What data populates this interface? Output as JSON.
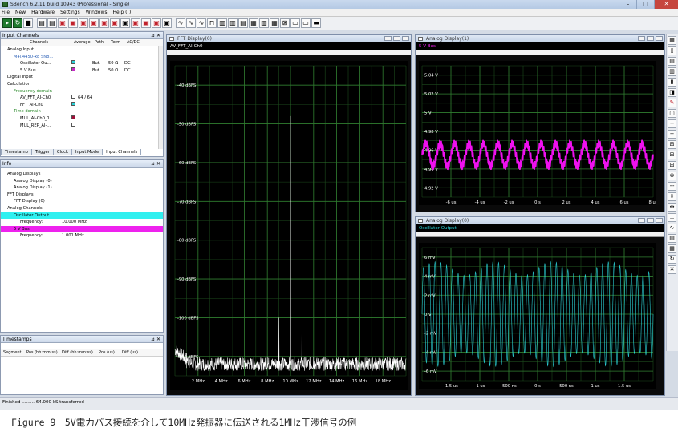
{
  "app": {
    "title": "SBench 6.2.11 build 10943 (Professional - Single)",
    "min": "–",
    "max": "□",
    "close": "✕"
  },
  "menu": [
    "File",
    "New",
    "Hardware",
    "Settings",
    "Windows",
    "Help (!)"
  ],
  "input_channels": {
    "header": "Input Channels",
    "columns": [
      "Channels",
      "Average",
      "Path",
      "Term",
      "AC/DC"
    ],
    "rows": [
      {
        "label": "Analog Input",
        "indent": 1,
        "swatch": "",
        "path": "",
        "term": "",
        "acdc": "",
        "avg": ""
      },
      {
        "label": "M4i.4450-x8 SN8...",
        "indent": 2,
        "swatch": "",
        "path": "",
        "term": "",
        "acdc": "",
        "avg": ""
      },
      {
        "label": "Oscillator Ou...",
        "indent": 3,
        "swatch": "#2bd3d8",
        "path": "Buf.",
        "term": "50 Ω",
        "acdc": "DC",
        "avg": ""
      },
      {
        "label": "5 V Bus",
        "indent": 3,
        "swatch": "#c728c7",
        "path": "Buf.",
        "term": "50 Ω",
        "acdc": "DC",
        "avg": ""
      },
      {
        "label": "Digital Input",
        "indent": 1,
        "swatch": "",
        "path": "",
        "term": "",
        "acdc": "",
        "avg": ""
      },
      {
        "label": "Calculation",
        "indent": 1,
        "swatch": "",
        "path": "",
        "term": "",
        "acdc": "",
        "avg": ""
      },
      {
        "label": "Frequency domain",
        "indent": 2,
        "swatch": "",
        "path": "",
        "term": "",
        "acdc": "",
        "avg": ""
      },
      {
        "label": "AV_FFT_AI-Ch0",
        "indent": 3,
        "swatch": "#ffffff",
        "path": "",
        "term": "",
        "acdc": "",
        "avg": "64 / 64"
      },
      {
        "label": "FFT_AI-Ch0",
        "indent": 3,
        "swatch": "#2bd3d8",
        "path": "",
        "term": "",
        "acdc": "",
        "avg": ""
      },
      {
        "label": "Time domain",
        "indent": 2,
        "swatch": "",
        "path": "",
        "term": "",
        "acdc": "",
        "avg": ""
      },
      {
        "label": "MUL_AI-Ch0_1",
        "indent": 3,
        "swatch": "#a0103a",
        "path": "",
        "term": "",
        "acdc": "",
        "avg": ""
      },
      {
        "label": "MUL_REP_AI-...",
        "indent": 3,
        "swatch": "#ffffff",
        "path": "",
        "term": "",
        "acdc": "",
        "avg": ""
      }
    ],
    "tabs": [
      "Timestamp",
      "Trigger",
      "Clock",
      "Input Mode",
      "Input Channels"
    ]
  },
  "info": {
    "header": "Info",
    "rows": [
      {
        "label": "Analog Displays",
        "indent": 1,
        "bg": ""
      },
      {
        "label": "Analog Display (0)",
        "indent": 2,
        "bg": ""
      },
      {
        "label": "Analog Display (1)",
        "indent": 2,
        "bg": ""
      },
      {
        "label": "FFT Displays",
        "indent": 1,
        "bg": ""
      },
      {
        "label": "FFT Display (0)",
        "indent": 2,
        "bg": ""
      },
      {
        "label": "Analog Channels",
        "indent": 1,
        "bg": ""
      },
      {
        "label": "Oscillator Output",
        "indent": 2,
        "bg": "#30f0f0"
      },
      {
        "label": "Frequency:",
        "value": "10.000 MHz",
        "indent": 3,
        "bg": ""
      },
      {
        "label": "5 V Bus",
        "indent": 2,
        "bg": "#ee22ee"
      },
      {
        "label": "Frequency:",
        "value": "1.001 MHz",
        "indent": 3,
        "bg": ""
      }
    ]
  },
  "timestamps": {
    "header": "Timestamps",
    "columns": [
      "Segment",
      "Pos (hh:mm:ss)",
      "Diff (hh:mm:ss)",
      "Pos (us)",
      "Diff (us)"
    ]
  },
  "status": "Finished ......... 64.000 kS transferred",
  "fft_window": {
    "title": "FFT Display(0)",
    "channel": "AV_FFT_AI-Ch0"
  },
  "ad1_window": {
    "title": "Analog Display(1)",
    "channel": "5 V Bus"
  },
  "ad0_window": {
    "title": "Analog Display(0)",
    "channel": "Oscillator Output"
  },
  "caption": "Figure 9　5V電力バス接続を介して10MHz発振器に伝送される1MHz干渉信号の例",
  "chart_data": [
    {
      "type": "line",
      "title": "FFT Display(0)",
      "series_name": "AV_FFT_AI-Ch0",
      "color": "#ffffff",
      "xlabel": "",
      "ylabel": "",
      "xlim": [
        0,
        20
      ],
      "ylim": [
        -115,
        -35
      ],
      "x_ticks": [
        "2 MHz",
        "4 MHz",
        "6 MHz",
        "8 MHz",
        "10 MHz",
        "12 MHz",
        "14 MHz",
        "16 MHz",
        "18 MHz"
      ],
      "y_ticks": [
        "-40 dBFS",
        "-50 dBFS",
        "-60 dBFS",
        "-70 dBFS",
        "-80 dBFS",
        "-90 dBFS",
        "-100 dBFS",
        "-110 dBFS"
      ],
      "peaks": [
        {
          "x": 10.0,
          "y": -48
        },
        {
          "x": 9.0,
          "y": -100
        },
        {
          "x": 11.0,
          "y": -100
        },
        {
          "x": 1.0,
          "y": -109
        },
        {
          "x": 8.0,
          "y": -110
        },
        {
          "x": 12.0,
          "y": -110
        }
      ],
      "noise_floor": -113,
      "grid": true
    },
    {
      "type": "line",
      "title": "Analog Display(1)",
      "series_name": "5 V Bus",
      "color": "#ee11ee",
      "xlabel": "",
      "ylabel": "",
      "xlim": [
        -8,
        8
      ],
      "ylim": [
        4.91,
        5.05
      ],
      "x_ticks": [
        "-6 us",
        "-4 us",
        "-2 us",
        "0 s",
        "2 us",
        "4 us",
        "6 us",
        "8 us"
      ],
      "y_ticks": [
        "5.04 V",
        "5.02 V",
        "5 V",
        "4.98 V",
        "4.96 V",
        "4.94 V",
        "4.92 V"
      ],
      "signal": {
        "offset": 4.955,
        "amplitude": 0.012,
        "frequency_mhz": 1.001,
        "ripple": 0.004
      },
      "grid": true
    },
    {
      "type": "line",
      "title": "Analog Display(0)",
      "series_name": "Oscillator Output",
      "color": "#2bd3d8",
      "xlabel": "",
      "ylabel": "",
      "xlim": [
        -2000,
        2000
      ],
      "ylim": [
        -7,
        7
      ],
      "x_ticks": [
        "-1.5 us",
        "-1 us",
        "-500 ns",
        "0 s",
        "500 ns",
        "1 us",
        "1.5 us"
      ],
      "y_ticks": [
        "6 mV",
        "4 mV",
        "2 mV",
        "0 V",
        "-2 mV",
        "-4 mV",
        "-6 mV"
      ],
      "signal": {
        "amplitude": 4.8,
        "frequency_mhz": 10.0,
        "am_depth": 0.15,
        "am_frequency_mhz": 1.001
      },
      "grid": true
    }
  ]
}
